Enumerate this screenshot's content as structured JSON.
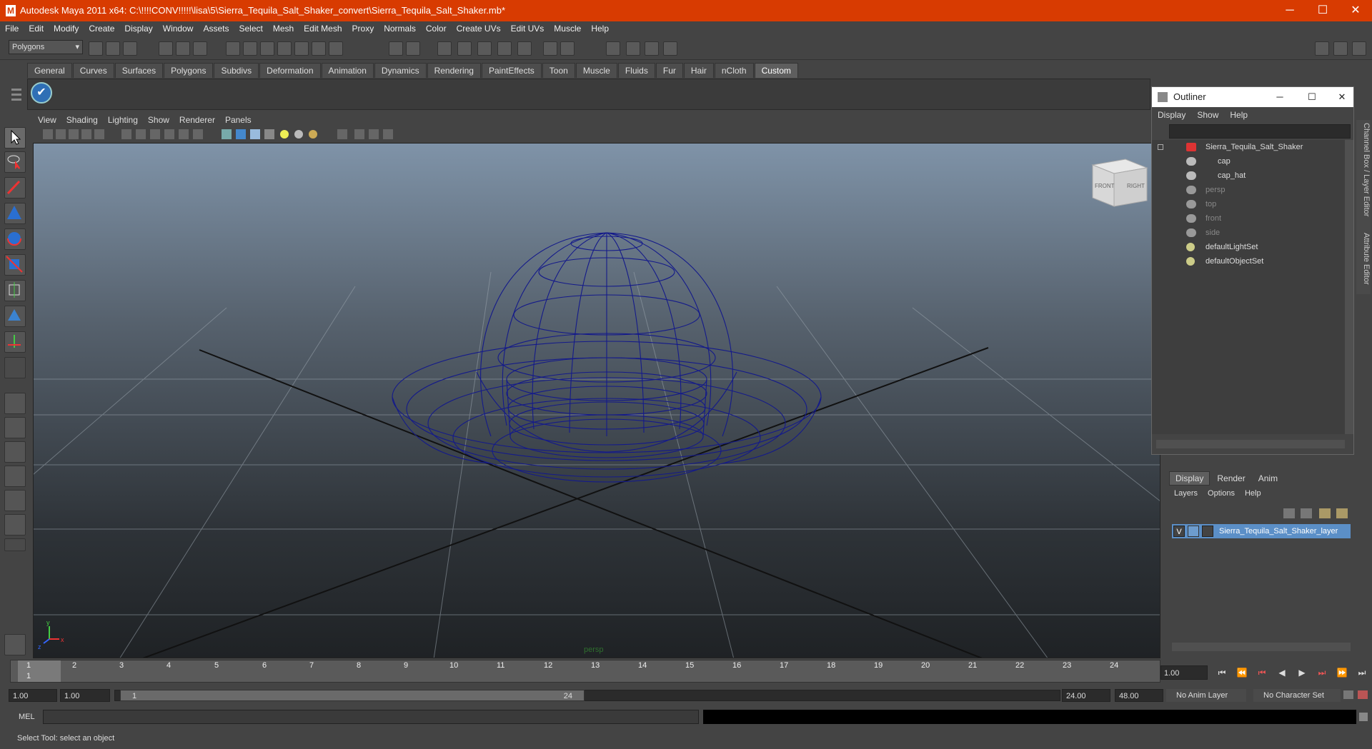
{
  "window": {
    "title": "Autodesk Maya 2011 x64: C:\\!!!!CONV!!!!!\\lisa\\5\\Sierra_Tequila_Salt_Shaker_convert\\Sierra_Tequila_Salt_Shaker.mb*",
    "minimize": "─",
    "maximize": "☐",
    "close": "✕"
  },
  "menu": [
    "File",
    "Edit",
    "Modify",
    "Create",
    "Display",
    "Window",
    "Assets",
    "Select",
    "Mesh",
    "Edit Mesh",
    "Proxy",
    "Normals",
    "Color",
    "Create UVs",
    "Edit UVs",
    "Muscle",
    "Help"
  ],
  "status": {
    "mode_selector": "Polygons"
  },
  "shelf_tabs": [
    "General",
    "Curves",
    "Surfaces",
    "Polygons",
    "Subdivs",
    "Deformation",
    "Animation",
    "Dynamics",
    "Rendering",
    "PaintEffects",
    "Toon",
    "Muscle",
    "Fluids",
    "Fur",
    "Hair",
    "nCloth",
    "Custom"
  ],
  "active_shelf_tab": "Custom",
  "viewport": {
    "menu": [
      "View",
      "Shading",
      "Lighting",
      "Show",
      "Renderer",
      "Panels"
    ],
    "camera_label": "persp",
    "viewcube": {
      "front": "FRONT",
      "right": "RIGHT"
    },
    "axis": {
      "x": "x",
      "y": "y",
      "z": "z"
    }
  },
  "outliner": {
    "title": "Outliner",
    "menu": [
      "Display",
      "Show",
      "Help"
    ],
    "items": [
      {
        "label": "Sierra_Tequila_Salt_Shaker",
        "dim": false
      },
      {
        "label": "cap",
        "dim": false
      },
      {
        "label": "cap_hat",
        "dim": false
      },
      {
        "label": "persp",
        "dim": true
      },
      {
        "label": "top",
        "dim": true
      },
      {
        "label": "front",
        "dim": true
      },
      {
        "label": "side",
        "dim": true
      },
      {
        "label": "defaultLightSet",
        "dim": false
      },
      {
        "label": "defaultObjectSet",
        "dim": false
      }
    ]
  },
  "side_tabs": {
    "channel_box": "Channel Box / Layer Editor",
    "attribute_editor": "Attribute Editor"
  },
  "layer_editor": {
    "tabs": [
      "Display",
      "Render",
      "Anim"
    ],
    "active_tab": "Display",
    "menu": [
      "Layers",
      "Options",
      "Help"
    ],
    "layer": {
      "visibility": "V",
      "name": "Sierra_Tequila_Salt_Shaker_layer"
    }
  },
  "timeline": {
    "ticks": [
      "1",
      "2",
      "3",
      "4",
      "5",
      "6",
      "7",
      "8",
      "9",
      "10",
      "11",
      "12",
      "13",
      "14",
      "15",
      "16",
      "17",
      "18",
      "19",
      "20",
      "21",
      "22",
      "23",
      "24"
    ],
    "current_frame": "1",
    "current_time_field": "1.00"
  },
  "range": {
    "start_time": "1.00",
    "playback_start": "1.00",
    "slider_start": "1",
    "slider_end": "24",
    "playback_end": "24.00",
    "end_time": "48.00",
    "anim_layer": "No Anim Layer",
    "character_set": "No Character Set"
  },
  "command": {
    "label": "MEL"
  },
  "help_line": "Select Tool: select an object",
  "colors": {
    "titlebar": "#d83b01",
    "wire": "#141a8a",
    "selected_layer": "#5b8fc7"
  }
}
